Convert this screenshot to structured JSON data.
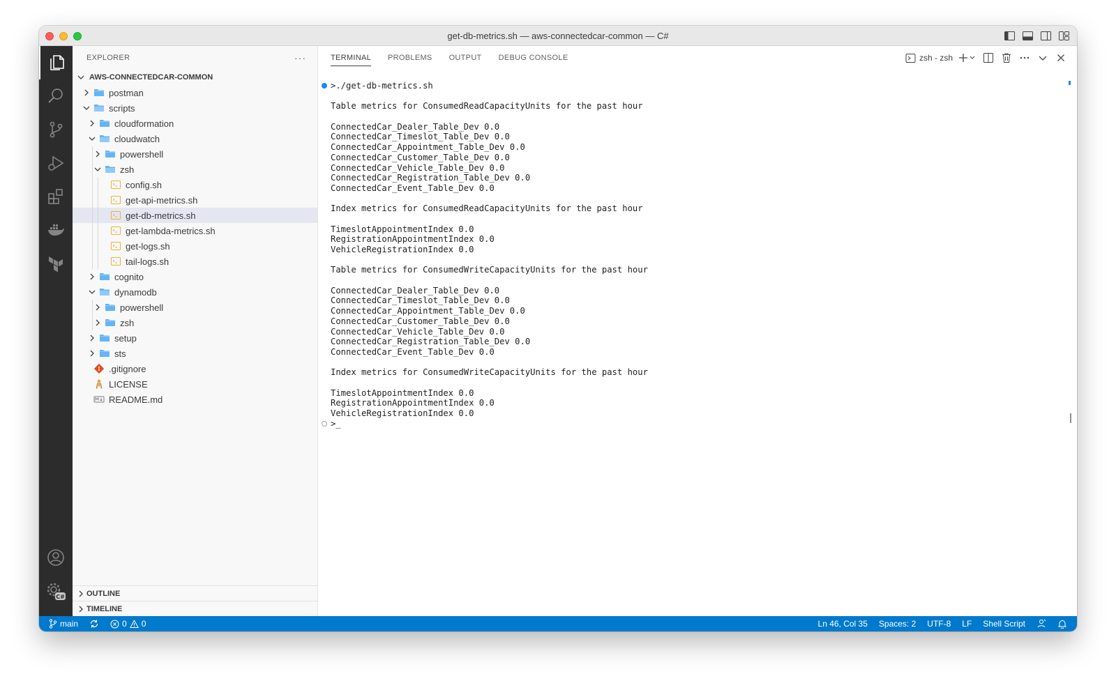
{
  "window": {
    "title": "get-db-metrics.sh — aws-connectedcar-common — C#"
  },
  "activity_bar": {
    "icons": [
      "files-icon",
      "search-icon",
      "source-control-icon",
      "run-debug-icon",
      "extensions-icon",
      "docker-icon",
      "terraform-icon",
      "account-icon",
      "manage-gear-icon"
    ],
    "gear_badge": "C#"
  },
  "explorer": {
    "header": "EXPLORER",
    "root": "AWS-CONNECTEDCAR-COMMON",
    "tree": [
      {
        "label": "postman",
        "type": "folder",
        "depth": 1,
        "expanded": false
      },
      {
        "label": "scripts",
        "type": "folder",
        "depth": 1,
        "expanded": true
      },
      {
        "label": "cloudformation",
        "type": "folder",
        "depth": 2,
        "expanded": false
      },
      {
        "label": "cloudwatch",
        "type": "folder",
        "depth": 2,
        "expanded": true
      },
      {
        "label": "powershell",
        "type": "folder",
        "depth": 3,
        "expanded": false
      },
      {
        "label": "zsh",
        "type": "folder",
        "depth": 3,
        "expanded": true
      },
      {
        "label": "config.sh",
        "type": "shell",
        "depth": 4
      },
      {
        "label": "get-api-metrics.sh",
        "type": "shell",
        "depth": 4
      },
      {
        "label": "get-db-metrics.sh",
        "type": "shell",
        "depth": 4,
        "selected": true
      },
      {
        "label": "get-lambda-metrics.sh",
        "type": "shell",
        "depth": 4
      },
      {
        "label": "get-logs.sh",
        "type": "shell",
        "depth": 4
      },
      {
        "label": "tail-logs.sh",
        "type": "shell",
        "depth": 4
      },
      {
        "label": "cognito",
        "type": "folder",
        "depth": 2,
        "expanded": false
      },
      {
        "label": "dynamodb",
        "type": "folder",
        "depth": 2,
        "expanded": true
      },
      {
        "label": "powershell",
        "type": "folder",
        "depth": 3,
        "expanded": false
      },
      {
        "label": "zsh",
        "type": "folder",
        "depth": 3,
        "expanded": false
      },
      {
        "label": "setup",
        "type": "folder",
        "depth": 2,
        "expanded": false
      },
      {
        "label": "sts",
        "type": "folder",
        "depth": 2,
        "expanded": false
      },
      {
        "label": ".gitignore",
        "type": "git",
        "depth": 1
      },
      {
        "label": "LICENSE",
        "type": "license",
        "depth": 1
      },
      {
        "label": "README.md",
        "type": "markdown",
        "depth": 1
      }
    ],
    "outline": "OUTLINE",
    "timeline": "TIMELINE"
  },
  "panel": {
    "tabs": [
      "TERMINAL",
      "PROBLEMS",
      "OUTPUT",
      "DEBUG CONSOLE"
    ],
    "active_tab": "TERMINAL",
    "terminal_name": "zsh - zsh"
  },
  "terminal": {
    "lines": [
      ">./get-db-metrics.sh",
      "",
      "Table metrics for ConsumedReadCapacityUnits for the past hour",
      "",
      "ConnectedCar_Dealer_Table_Dev 0.0",
      "ConnectedCar_Timeslot_Table_Dev 0.0",
      "ConnectedCar_Appointment_Table_Dev 0.0",
      "ConnectedCar_Customer_Table_Dev 0.0",
      "ConnectedCar_Vehicle_Table_Dev 0.0",
      "ConnectedCar_Registration_Table_Dev 0.0",
      "ConnectedCar_Event_Table_Dev 0.0",
      "",
      "Index metrics for ConsumedReadCapacityUnits for the past hour",
      "",
      "TimeslotAppointmentIndex 0.0",
      "RegistrationAppointmentIndex 0.0",
      "VehicleRegistrationIndex 0.0",
      "",
      "Table metrics for ConsumedWriteCapacityUnits for the past hour",
      "",
      "ConnectedCar_Dealer_Table_Dev 0.0",
      "ConnectedCar_Timeslot_Table_Dev 0.0",
      "ConnectedCar_Appointment_Table_Dev 0.0",
      "ConnectedCar_Customer_Table_Dev 0.0",
      "ConnectedCar_Vehicle_Table_Dev 0.0",
      "ConnectedCar_Registration_Table_Dev 0.0",
      "ConnectedCar_Event_Table_Dev 0.0",
      "",
      "Index metrics for ConsumedWriteCapacityUnits for the past hour",
      "",
      "TimeslotAppointmentIndex 0.0",
      "RegistrationAppointmentIndex 0.0",
      "VehicleRegistrationIndex 0.0",
      ">_"
    ]
  },
  "statusbar": {
    "branch": "main",
    "errors": "0",
    "warnings": "0",
    "cursor": "Ln 46, Col 35",
    "spaces": "Spaces: 2",
    "encoding": "UTF-8",
    "eol": "LF",
    "language": "Shell Script"
  },
  "colors": {
    "statusbar": "#007acc",
    "activitybar": "#2c2c2c",
    "folder": "#64b5f6",
    "accent": "#1a85ff"
  }
}
